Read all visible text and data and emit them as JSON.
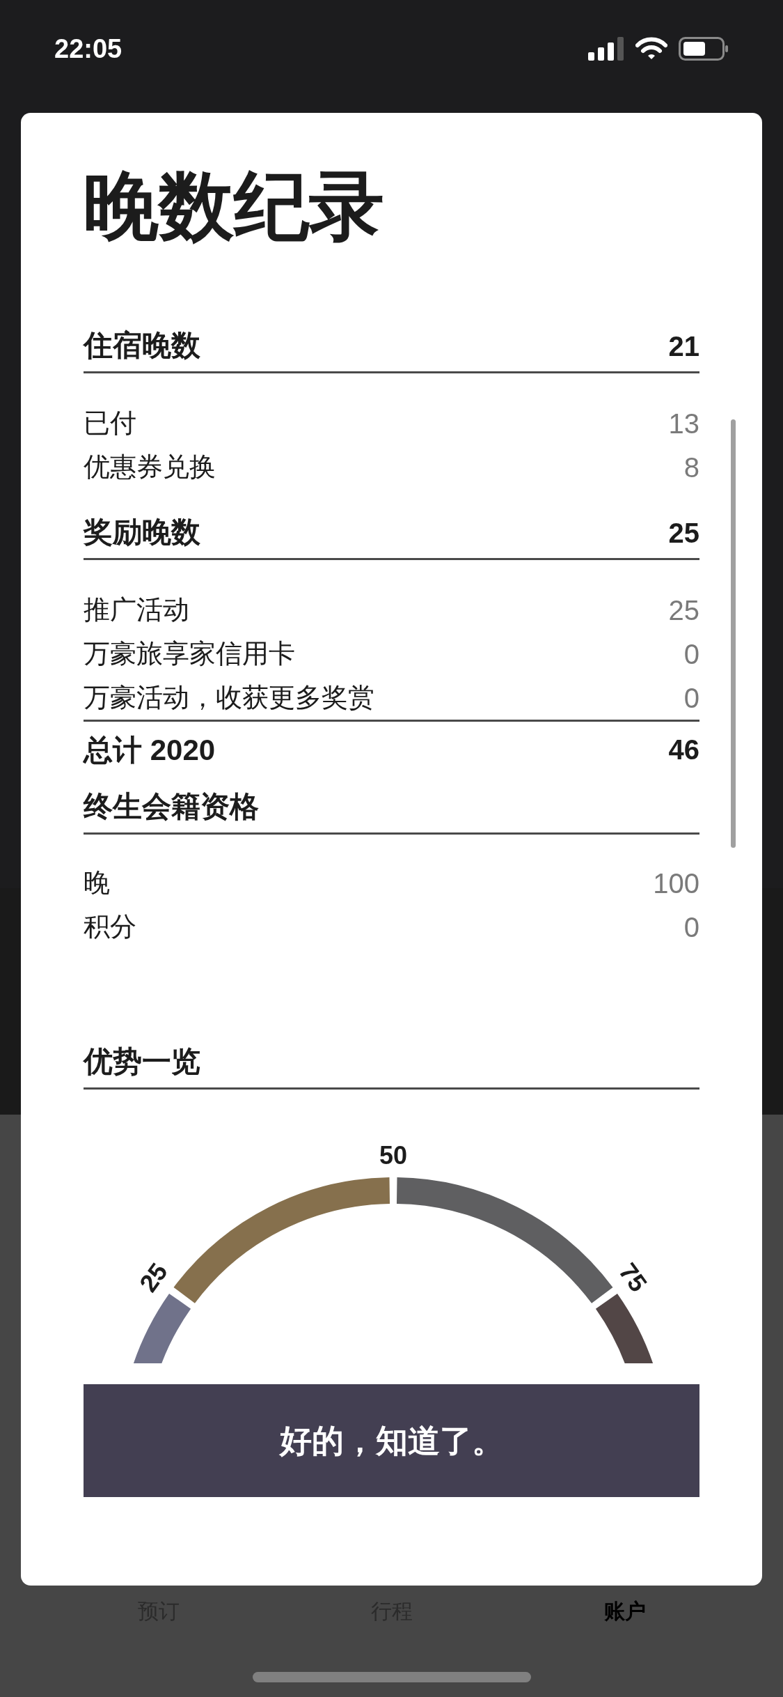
{
  "status_bar": {
    "time": "22:05"
  },
  "dialog": {
    "title": "晚数纪录",
    "sections": [
      {
        "title": "住宿晚数",
        "total": "21",
        "items": [
          {
            "label": "已付",
            "value": "13"
          },
          {
            "label": "优惠券兑换",
            "value": "8"
          }
        ]
      },
      {
        "title": "奖励晚数",
        "total": "25",
        "items": [
          {
            "label": "推广活动",
            "value": "25"
          },
          {
            "label": "万豪旅享家信用卡",
            "value": "0"
          },
          {
            "label": "万豪活动，收获更多奖赏",
            "value": "0"
          }
        ]
      }
    ],
    "grand_total": {
      "label": "总计 2020",
      "value": "46"
    },
    "lifetime": {
      "title": "终生会籍资格",
      "items": [
        {
          "label": "晚",
          "value": "100"
        },
        {
          "label": "积分",
          "value": "0"
        }
      ]
    },
    "overview": {
      "title": "优势一览",
      "gauge": {
        "ticks": [
          "25",
          "50",
          "75"
        ],
        "segments": [
          {
            "color": "#70728a"
          },
          {
            "color": "#86704d"
          },
          {
            "color": "#5f5f61"
          },
          {
            "color": "#524646"
          }
        ]
      }
    },
    "confirm_button": "好的，知道了。"
  },
  "tab_bar": [
    {
      "label": "预订",
      "selected": false
    },
    {
      "label": "行程",
      "selected": false
    },
    {
      "label": "账户",
      "selected": true
    }
  ]
}
